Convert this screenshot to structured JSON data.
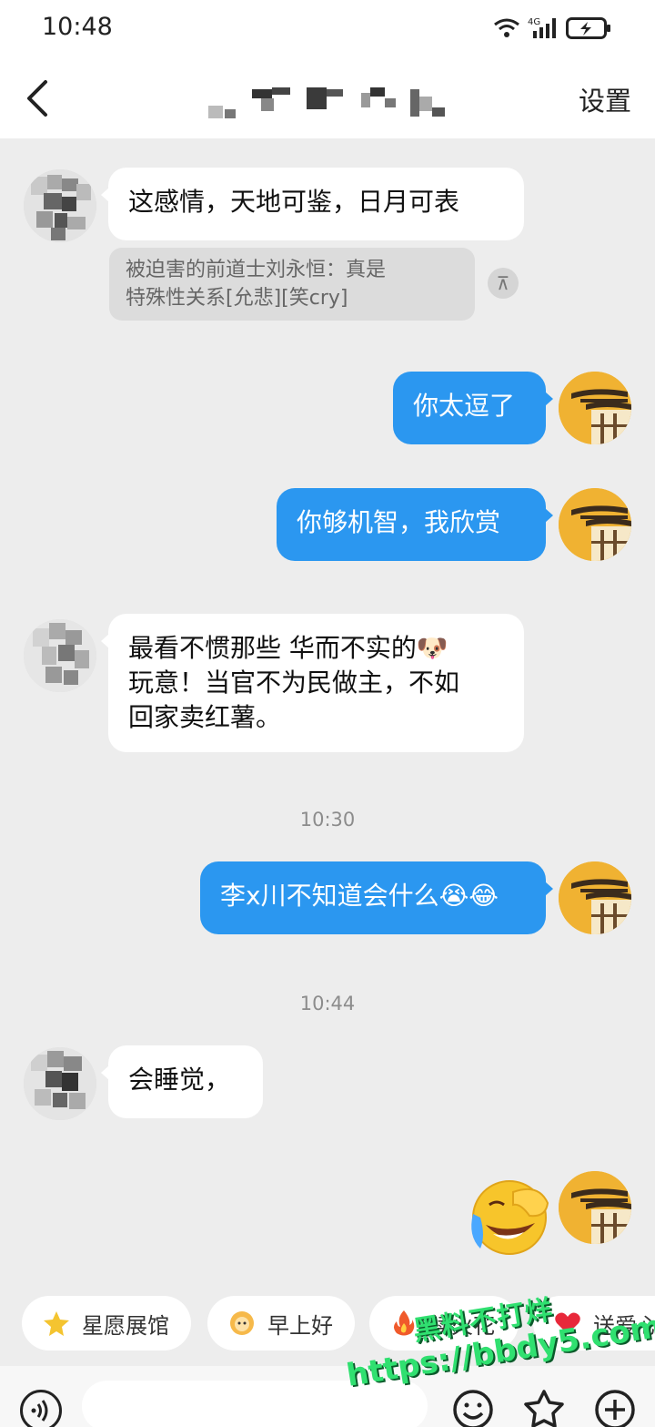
{
  "status_bar": {
    "time": "10:48",
    "network": "4G"
  },
  "nav": {
    "title": "",
    "settings_label": "设置"
  },
  "messages": {
    "m1": "这感情，天地可鉴，日月可表",
    "quote": "被迫害的前道士刘永恒：真是\n特殊性关系[允悲][笑cry]",
    "m2": "你太逗了",
    "m3": "你够机智，我欣赏",
    "m4": "最看不惯那些 华而不实的🐶\n玩意！当官不为民做主，不如\n回家卖红薯。",
    "t1": "10:30",
    "m5": "李x川不知道会什么😭😂",
    "t2": "10:44",
    "m6": "会睡觉，"
  },
  "quick_actions": [
    {
      "label": "星愿展馆",
      "icon": "star-icon"
    },
    {
      "label": "早上好",
      "icon": "sun-face-icon"
    },
    {
      "label": "续火花",
      "icon": "fire-icon"
    },
    {
      "label": "送爱心",
      "icon": "heart-icon"
    }
  ],
  "input": {
    "placeholder": ""
  },
  "watermark": {
    "line1": "黑料不打烊",
    "line2": "https://bbdy5.com"
  },
  "colors": {
    "outgoing_bubble": "#2b97f0",
    "incoming_bubble": "#ffffff",
    "background": "#ededed"
  }
}
